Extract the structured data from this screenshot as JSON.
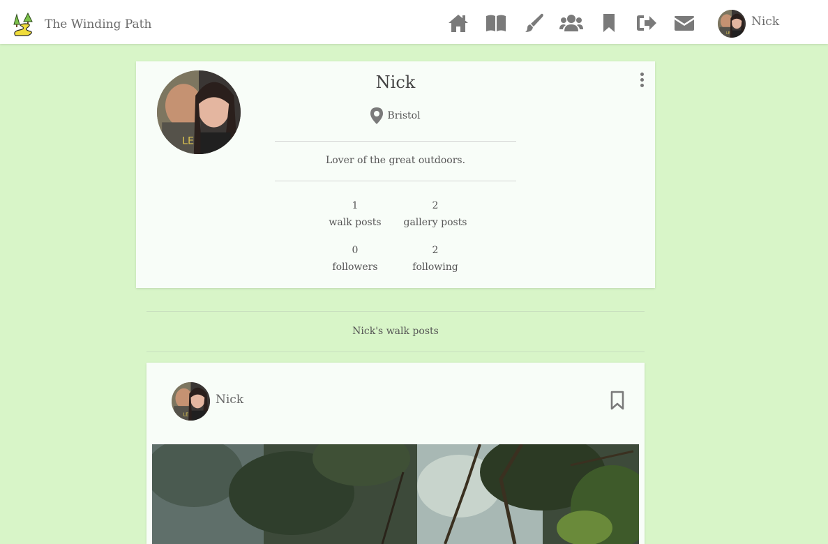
{
  "navbar": {
    "brand_title": "The Winding Path",
    "icons": [
      "home-icon",
      "book-icon",
      "paintbrush-icon",
      "users-icon",
      "bookmark-icon",
      "sign-out-icon",
      "envelope-icon"
    ],
    "user_name": "Nick"
  },
  "profile": {
    "name": "Nick",
    "location": "Bristol",
    "bio": "Lover of the great outdoors.",
    "stats": {
      "walk_posts_count": "1",
      "walk_posts_label": "walk posts",
      "gallery_posts_count": "2",
      "gallery_posts_label": "gallery posts",
      "followers_count": "0",
      "followers_label": "followers",
      "following_count": "2",
      "following_label": "following"
    }
  },
  "section": {
    "title": "Nick's walk posts"
  },
  "post": {
    "author_name": "Nick"
  },
  "colors": {
    "background": "#d8f5c8",
    "card": "#f8fdf8",
    "icon": "#7a7a7a"
  }
}
